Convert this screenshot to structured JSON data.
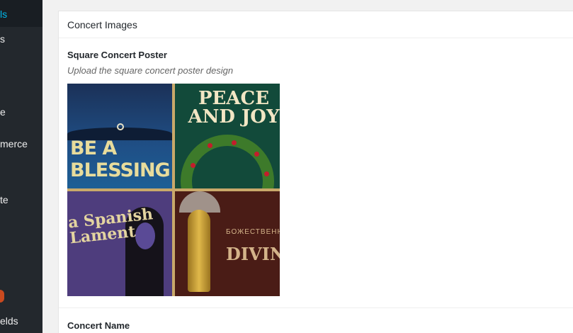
{
  "sidebar": {
    "items": [
      {
        "label": "ls"
      },
      {
        "label": "s"
      },
      {
        "label": "e"
      },
      {
        "label": "merce"
      },
      {
        "label": "te"
      },
      {
        "label": "elds"
      }
    ]
  },
  "metabox": {
    "title": "Concert Images",
    "poster_field": {
      "label": "Square Concert Poster",
      "description": "Upload the square concert poster design",
      "tiles": [
        {
          "text": "BE A BLESSING"
        },
        {
          "text": "PEACE AND JOY"
        },
        {
          "text": "a Spanish Lament"
        },
        {
          "small": "БОЖЕСТВЕННАЯ",
          "text": "DIVINE"
        }
      ]
    },
    "name_field": {
      "label": "Concert Name"
    }
  },
  "colors": {
    "sidebar_bg": "#23282d",
    "sidebar_active": "#00b9eb",
    "notification_badge": "#ca4a1f"
  }
}
